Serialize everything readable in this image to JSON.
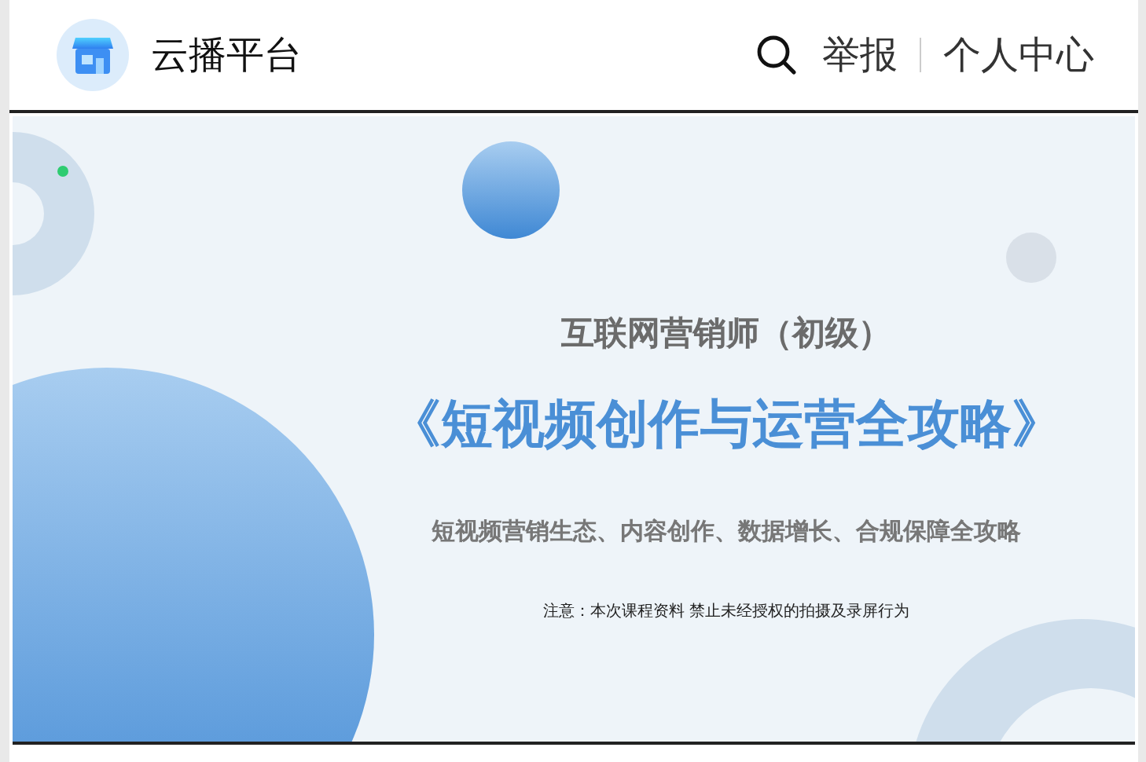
{
  "header": {
    "title": "云播平台",
    "actions": [
      {
        "kind": "search"
      },
      {
        "kind": "link",
        "label": "举报"
      },
      {
        "kind": "link",
        "label": "个人中心"
      }
    ]
  },
  "slide": {
    "kicker": "互联网营销师（初级）",
    "title": "《短视频创作与运营全攻略》",
    "subtitle": "短视频营销生态、内容创作、数据增长、合规保障全攻略",
    "notice": "注意：本次课程资料 禁止未经授权的拍摄及录屏行为"
  }
}
